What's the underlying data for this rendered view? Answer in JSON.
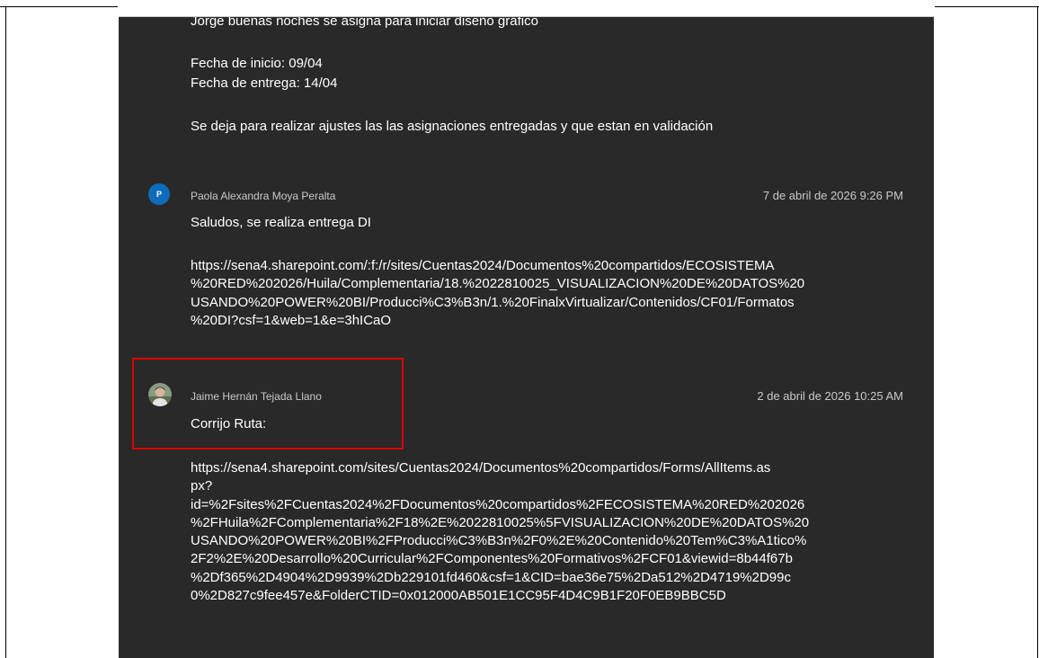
{
  "thread": {
    "first_message": {
      "line1": "Jorge buenas noches se asigna para iniciar diseño gráfico",
      "start_date": "Fecha de inicio: 09/04",
      "end_date": "Fecha de entrega: 14/04",
      "note": "Se deja para realizar ajustes las las asignaciones entregadas y que estan en validación"
    },
    "message_paola": {
      "avatar_initial": "P",
      "author": "Paola Alexandra Moya Peralta",
      "timestamp": "7 de abril de 2026 9:26 PM",
      "body": "Saludos, se realiza entrega DI",
      "link_lines": [
        "https://sena4.sharepoint.com/:f:/r/sites/Cuentas2024/Documentos%20compartidos/ECOSISTEMA",
        "%20RED%202026/Huila/Complementaria/18.%2022810025_VISUALIZACION%20DE%20DATOS%20",
        "USANDO%20POWER%20BI/Producci%C3%B3n/1.%20FinalxVirtualizar/Contenidos/CF01/Formatos",
        "%20DI?csf=1&web=1&e=3hICaO"
      ]
    },
    "message_jaime": {
      "author": "Jaime Hernán Tejada Llano",
      "timestamp": "2 de abril de 2026 10:25 AM",
      "body": "Corrijo Ruta:",
      "link_lines": [
        "https://sena4.sharepoint.com/sites/Cuentas2024/Documentos%20compartidos/Forms/AllItems.as",
        "px?",
        "id=%2Fsites%2FCuentas2024%2FDocumentos%20compartidos%2FECOSISTEMA%20RED%202026",
        "%2FHuila%2FComplementaria%2F18%2E%2022810025%5FVISUALIZACION%20DE%20DATOS%20",
        "USANDO%20POWER%20BI%2FProducci%C3%B3n%2F0%2E%20Contenido%20Tem%C3%A1tico%",
        "2F2%2E%20Desarrollo%20Curricular%2FComponentes%20Formativos%2FCF01&viewid=8b44f67b",
        "%2Df365%2D4904%2D9939%2Db229101fd460&csf=1&CID=bae36e75%2Da512%2D4719%2D99c",
        "0%2D827c9fee457e&FolderCTID=0x012000AB501E1CC95F4D4C9B1F20F0EB9BBC5D"
      ]
    }
  },
  "colors": {
    "panel_bg": "#292929",
    "avatar_blue": "#0f6cbd",
    "highlight_red": "#e00000"
  }
}
